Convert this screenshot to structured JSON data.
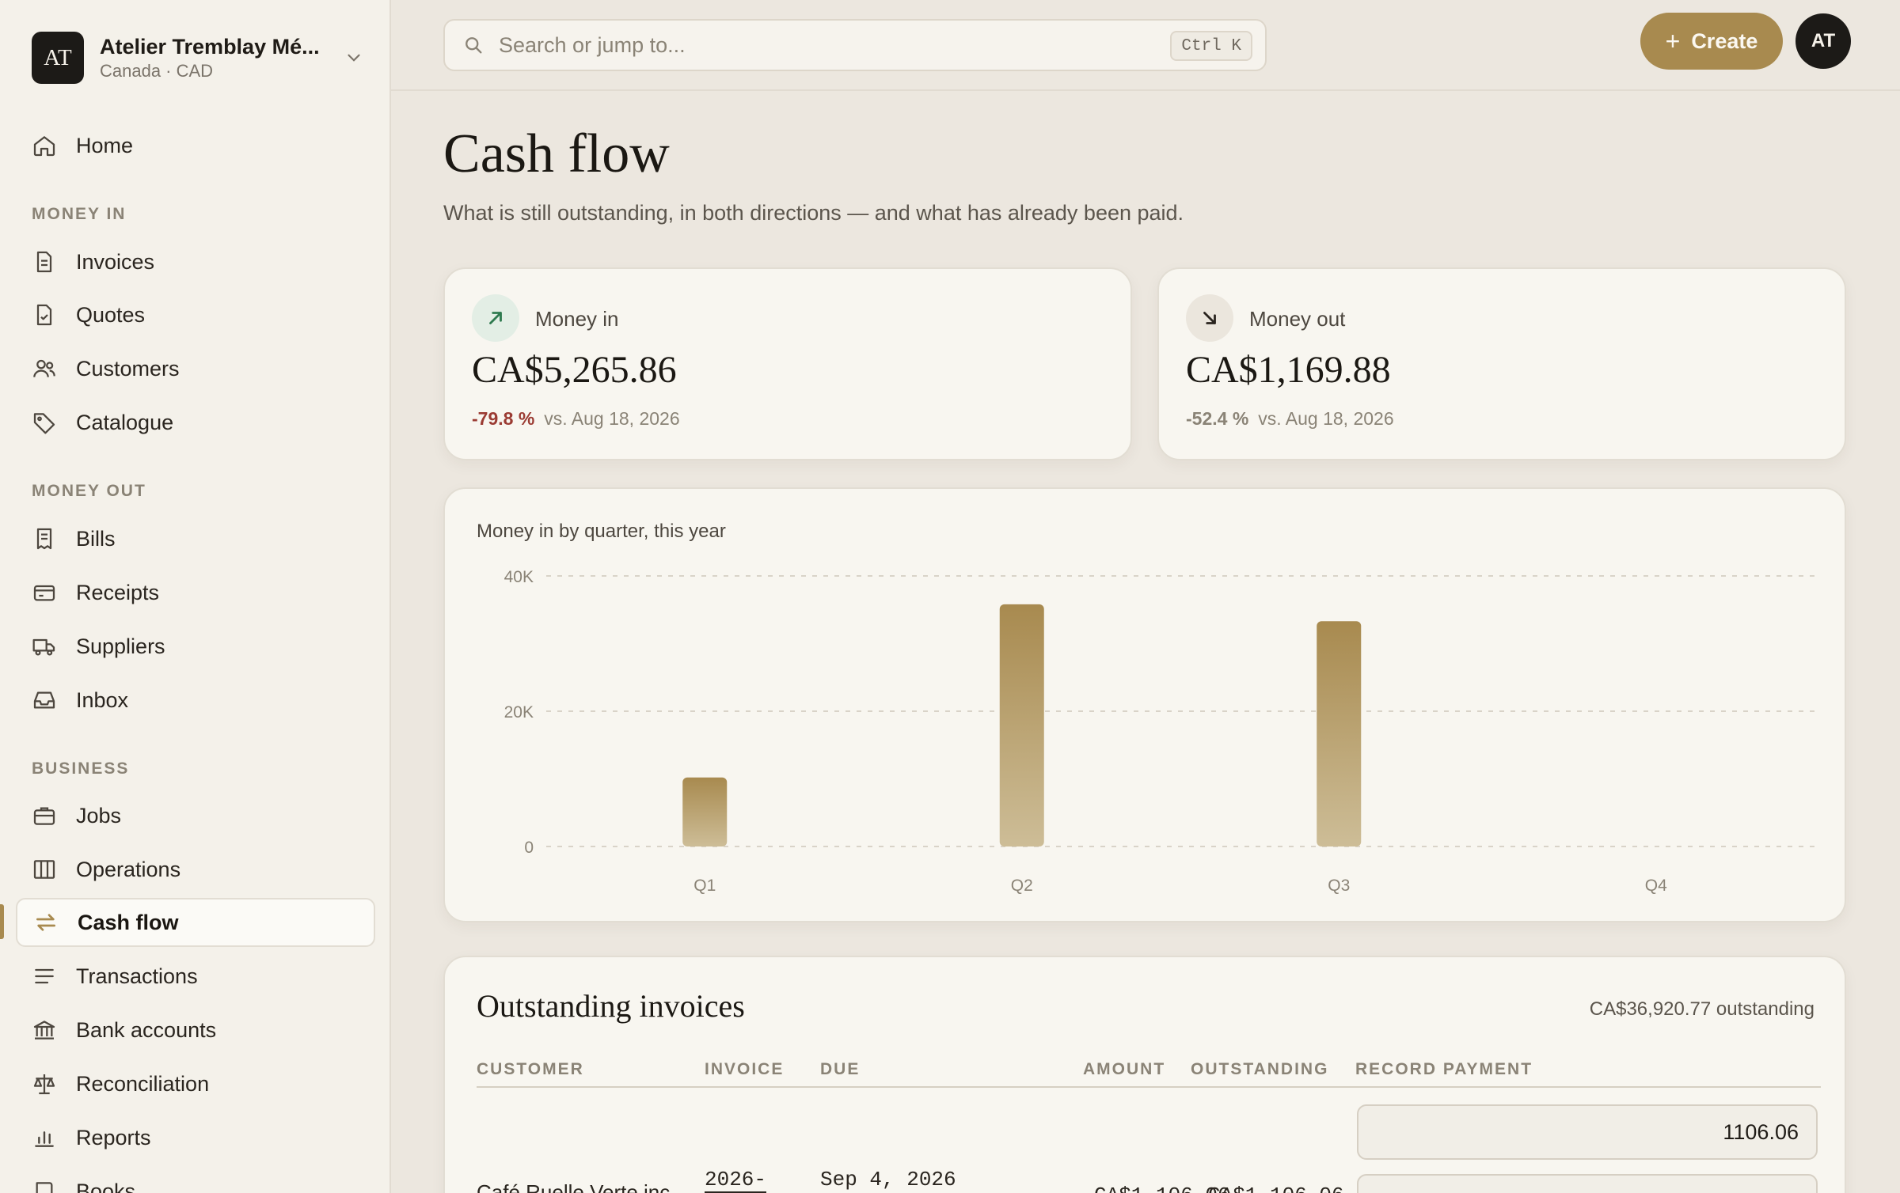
{
  "org": {
    "initials": "AT",
    "name": "Atelier Tremblay Mé...",
    "sub": "Canada · CAD"
  },
  "nav": {
    "home": "Home",
    "money_in_title": "MONEY IN",
    "money_in": [
      "Invoices",
      "Quotes",
      "Customers",
      "Catalogue"
    ],
    "money_out_title": "MONEY OUT",
    "money_out": [
      "Bills",
      "Receipts",
      "Suppliers",
      "Inbox"
    ],
    "business_title": "BUSINESS",
    "business": [
      "Jobs",
      "Operations",
      "Cash flow",
      "Transactions",
      "Bank accounts",
      "Reconciliation",
      "Reports",
      "Books"
    ]
  },
  "topbar": {
    "search_placeholder": "Search or jump to...",
    "shortcut": "Ctrl K",
    "create_label": "Create",
    "avatar_initials": "AT"
  },
  "page": {
    "title": "Cash flow",
    "subtitle": "What is still outstanding, in both directions — and what has already been paid."
  },
  "kpis": {
    "money_in": {
      "label": "Money in",
      "value": "CA$5,265.86",
      "delta": "-79.8 %",
      "compare": "vs. Aug 18, 2026",
      "delta_color": "#9b3b33"
    },
    "money_out": {
      "label": "Money out",
      "value": "CA$1,169.88",
      "delta": "-52.4 %",
      "compare": "vs. Aug 18, 2026",
      "delta_color": "#8a8376"
    }
  },
  "chart_data": {
    "type": "bar",
    "title": "Money in by quarter, this year",
    "categories": [
      "Q1",
      "Q2",
      "Q3",
      "Q4"
    ],
    "values": [
      10200,
      35800,
      33300,
      0
    ],
    "y_ticks": [
      "0",
      "20K",
      "40K"
    ],
    "ylim": [
      0,
      40000
    ],
    "grid": true,
    "bar_color": "#a88a4f",
    "xlabel": "",
    "ylabel": ""
  },
  "invoices": {
    "title": "Outstanding invoices",
    "total": "CA$36,920.77 outstanding",
    "columns": [
      "CUSTOMER",
      "INVOICE",
      "DUE",
      "AMOUNT",
      "OUTSTANDING",
      "RECORD PAYMENT"
    ],
    "rows": [
      {
        "customer": "Café Ruelle Verte inc.",
        "invoice": "2026-",
        "due": "Sep 4, 2026",
        "amount": "CA$1,106.06",
        "outstanding": "CA$1,106.06",
        "payment": "1106.06"
      }
    ]
  },
  "colors": {
    "accent": "#a88a4f",
    "positive": "#2f7a4f",
    "negative": "#9b3b33"
  }
}
